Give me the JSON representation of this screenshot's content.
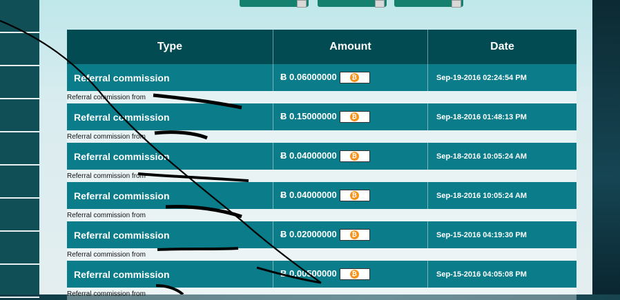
{
  "table": {
    "headers": {
      "type": "Type",
      "amount": "Amount",
      "date": "Date"
    },
    "rows": [
      {
        "type": "Referral commission",
        "amount": "Ƀ 0.06000000",
        "date": "Sep-19-2016 02:24:54 PM",
        "note": "Referral commission  from"
      },
      {
        "type": "Referral commission",
        "amount": "Ƀ 0.15000000",
        "date": "Sep-18-2016 01:48:13 PM",
        "note": "Referral commission  from"
      },
      {
        "type": "Referral commission",
        "amount": "Ƀ 0.04000000",
        "date": "Sep-18-2016 10:05:24 AM",
        "note": "Referral commission  from"
      },
      {
        "type": "Referral commission",
        "amount": "Ƀ 0.04000000",
        "date": "Sep-18-2016 10:05:24 AM",
        "note": "Referral commission  from"
      },
      {
        "type": "Referral commission",
        "amount": "Ƀ 0.02000000",
        "date": "Sep-15-2016 04:19:30 PM",
        "note": "Referral commission  from"
      },
      {
        "type": "Referral commission",
        "amount": "Ƀ 0.00500000",
        "date": "Sep-15-2016 04:05:08 PM",
        "note": "Referral commission  from"
      }
    ]
  },
  "icons": {
    "coin": "bitcoin-icon"
  },
  "colors": {
    "header_bg": "#024b52",
    "row_bg": "#0b7c8a",
    "sidebar_bg": "#0f4f55",
    "button_green": "#14806d"
  }
}
